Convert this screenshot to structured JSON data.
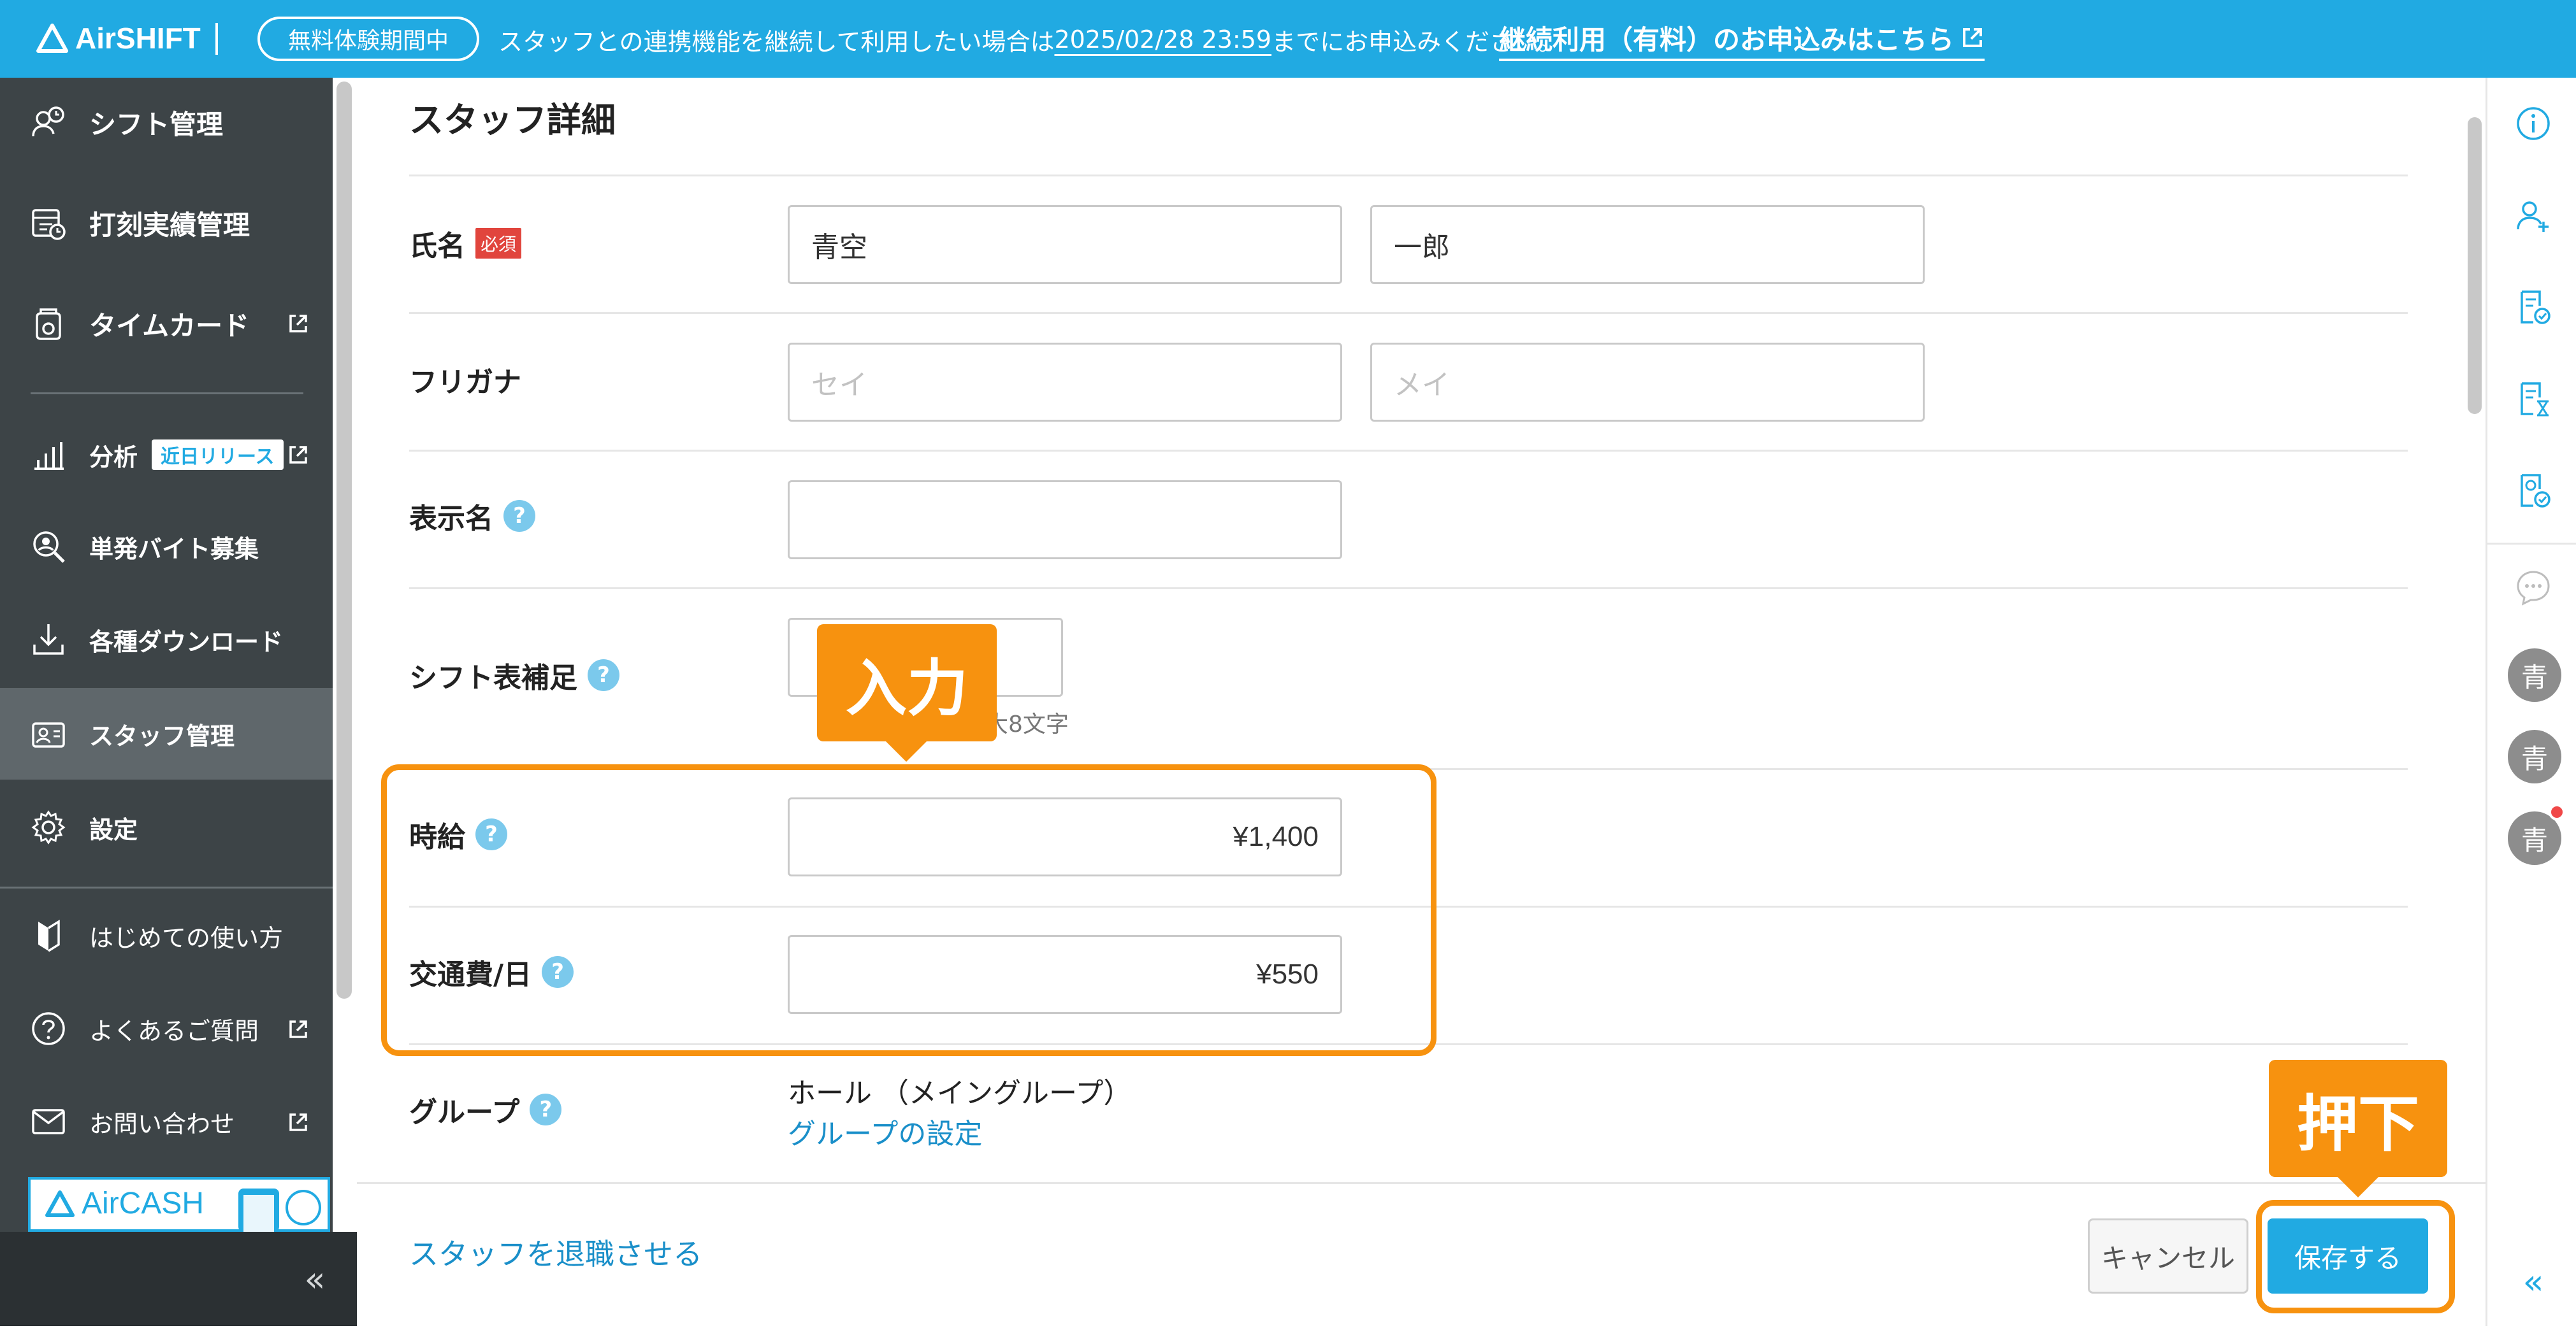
{
  "banner": {
    "logo": "AirSHIFT",
    "trial": "無料体験期間中",
    "message_before": "スタッフとの連携機能を継続して利用したい場合は",
    "message_date": "2025/02/28 23:59",
    "message_after": "までにお申込みください。",
    "link": "継続利用（有料）のお申込みはこちら"
  },
  "sidebar": {
    "items": [
      {
        "label": "シフト管理",
        "icon": "shift-icon"
      },
      {
        "label": "打刻実績管理",
        "icon": "timeclock-icon"
      },
      {
        "label": "タイムカード",
        "icon": "timecard-icon"
      },
      {
        "label": "分析",
        "icon": "analytics-icon",
        "badge": "近日リリース"
      },
      {
        "label": "単発バイト募集",
        "icon": "recruit-icon"
      },
      {
        "label": "各種ダウンロード",
        "icon": "download-icon"
      },
      {
        "label": "スタッフ管理",
        "icon": "staff-icon",
        "active": true
      },
      {
        "label": "設定",
        "icon": "gear-icon"
      },
      {
        "label": "はじめての使い方",
        "icon": "beginner-icon"
      },
      {
        "label": "よくあるご質問",
        "icon": "question-icon"
      },
      {
        "label": "お問い合わせ",
        "icon": "mail-icon"
      }
    ],
    "aircash": "AirCASH",
    "collapse": "«"
  },
  "form": {
    "title": "スタッフ詳細",
    "name_label": "氏名",
    "required": "必須",
    "last_name": "青空",
    "first_name": "一郎",
    "kana_label": "フリガナ",
    "kana_last_placeholder": "セイ",
    "kana_first_placeholder": "メイ",
    "display_label": "表示名",
    "shift_note_label": "シフト表補足",
    "shift_note_hint": "大8文字",
    "wage_label": "時給",
    "wage_value": "¥1,400",
    "transport_label": "交通費/日",
    "transport_value": "¥550",
    "group_label": "グループ",
    "group_value": "ホール （メイングループ）",
    "group_link": "グループの設定",
    "help": "?"
  },
  "footer": {
    "retire": "スタッフを退職させる",
    "cancel": "キャンセル",
    "save": "保存する"
  },
  "rail": {
    "avatars": [
      "青",
      "青",
      "青"
    ],
    "collapse": "«"
  },
  "annotations": {
    "input": "入力",
    "press": "押下",
    "color": "#f7920f"
  },
  "colors": {
    "accent": "#21aae2",
    "sidebar": "#3d4447",
    "required": "#e1453d",
    "link": "#1a8fc9"
  }
}
